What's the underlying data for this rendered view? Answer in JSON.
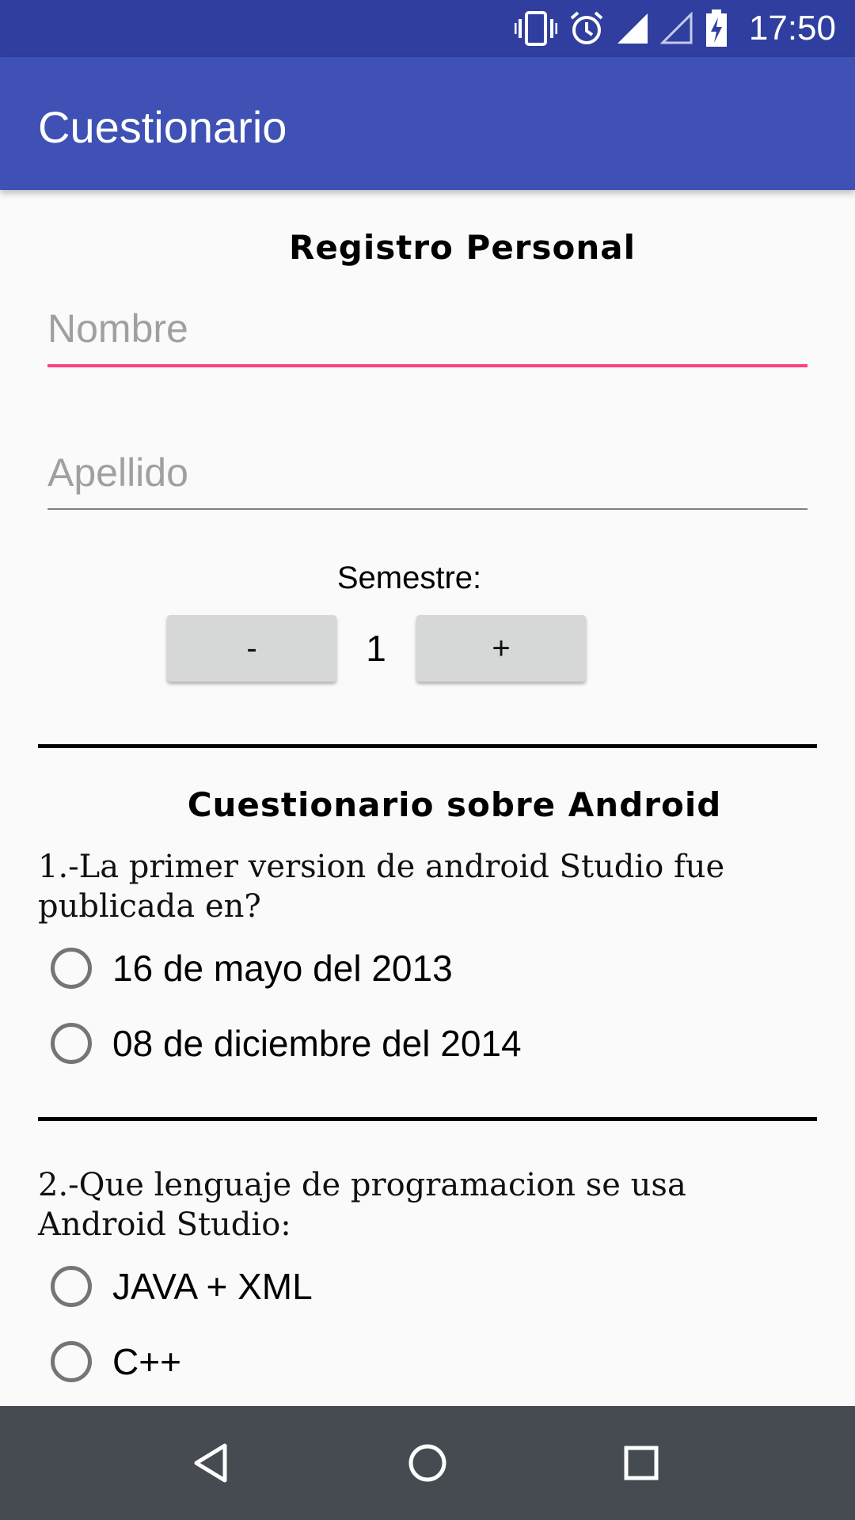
{
  "status_bar": {
    "time": "17:50",
    "icons": [
      "vibrate-icon",
      "alarm-icon",
      "signal-icon",
      "signal-empty-icon",
      "battery-charging-icon"
    ],
    "background": "#303f9f"
  },
  "app_bar": {
    "title": "Cuestionario",
    "background": "#3f51b5"
  },
  "registro": {
    "heading": "Registro Personal",
    "nombre_placeholder": "Nombre",
    "apellido_placeholder": "Apellido",
    "accent_color": "#ff4081"
  },
  "semestre": {
    "label": "Semestre:",
    "minus_label": "-",
    "value": "1",
    "plus_label": "+"
  },
  "quiz": {
    "heading": "Cuestionario sobre Android",
    "questions": [
      {
        "text": "1.-La primer version de android Studio fue publicada en?",
        "options": [
          "16 de mayo del 2013",
          "08 de diciembre del 2014"
        ]
      },
      {
        "text": "2.-Que lenguaje de programacion se usa Android Studio:",
        "options": [
          "JAVA + XML",
          "C++"
        ]
      }
    ]
  },
  "nav_bar": {
    "icons": [
      "back-icon",
      "home-icon",
      "recent-apps-icon"
    ],
    "background": "#454b51"
  }
}
